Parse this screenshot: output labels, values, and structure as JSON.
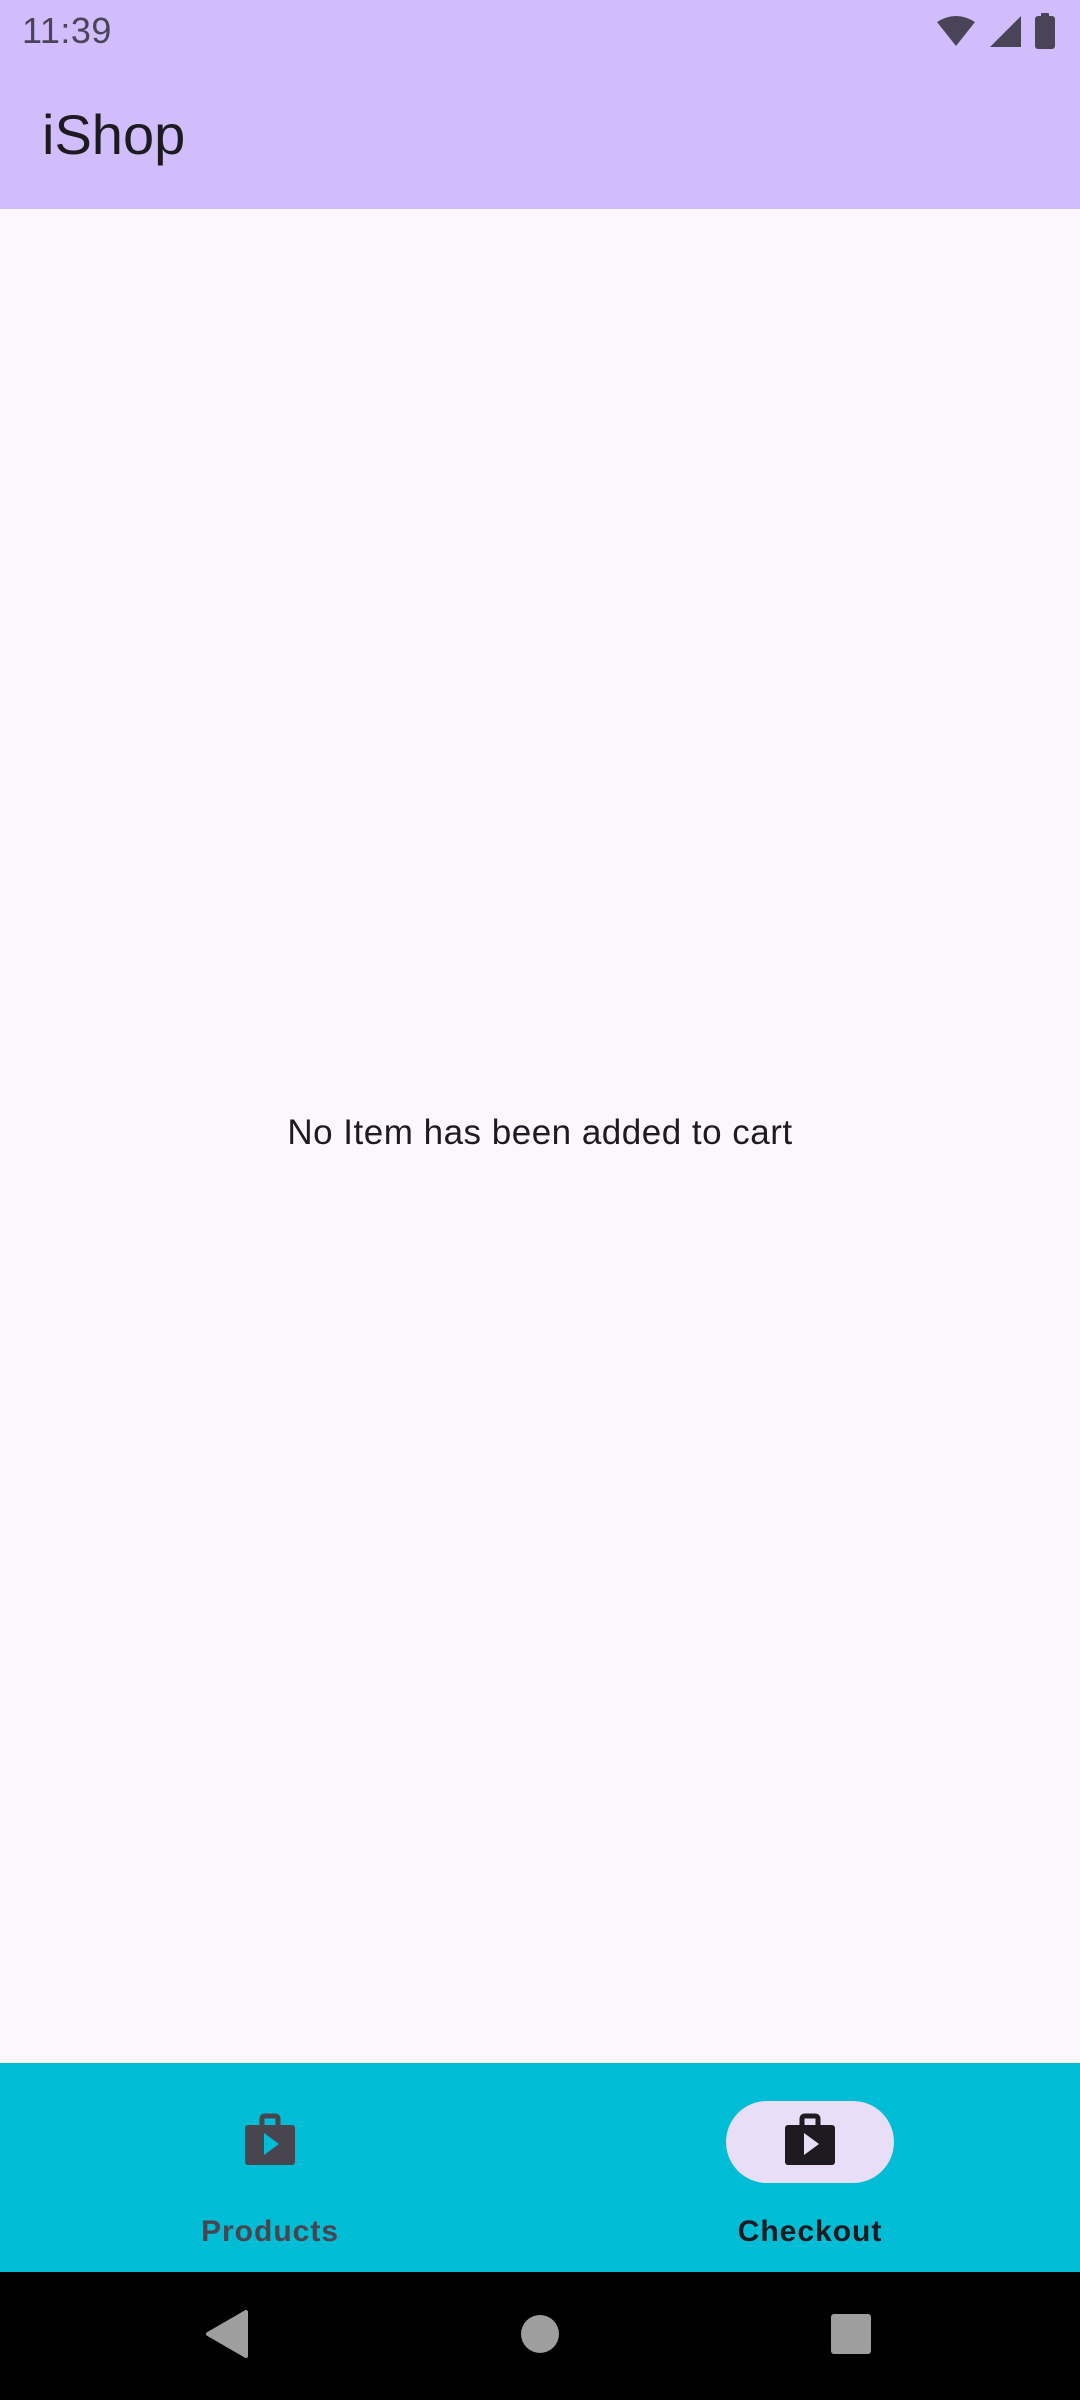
{
  "status_bar": {
    "time": "11:39",
    "icons": [
      "wifi-icon",
      "cellular-signal-icon",
      "battery-icon"
    ]
  },
  "app_bar": {
    "title": "iShop"
  },
  "content": {
    "empty_message": "No Item has been added to cart"
  },
  "bottom_nav": {
    "items": [
      {
        "label": "Products",
        "icon": "shop-bag-icon",
        "active": false
      },
      {
        "label": "Checkout",
        "icon": "shop-bag-icon",
        "active": true
      }
    ]
  },
  "system_nav": {
    "buttons": [
      "back-icon",
      "home-icon",
      "recents-icon"
    ]
  },
  "colors": {
    "app_bar_bg": "#d1bdfc",
    "content_bg": "#fcf7fd",
    "bottom_nav_bg": "#00bcd4",
    "active_indicator": "#e8def8",
    "text_primary": "#1d1b20"
  }
}
